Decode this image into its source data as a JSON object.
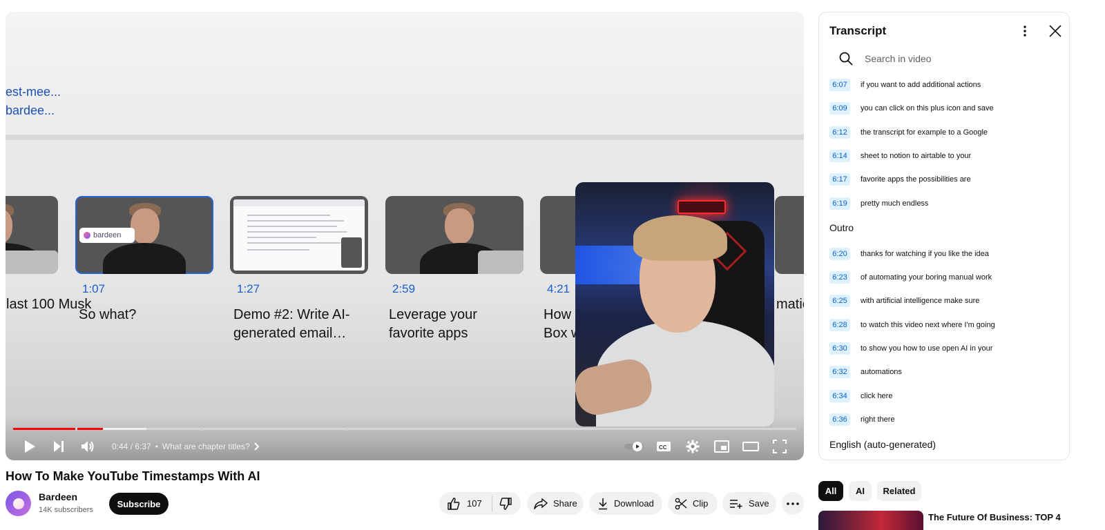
{
  "player": {
    "overlay_links": [
      "est-mee...",
      "bardee..."
    ],
    "chapters": [
      {
        "time": "",
        "title": "last 100 Musk",
        "style": "person",
        "active": false,
        "partial": "left"
      },
      {
        "time": "1:07",
        "title": "So what?",
        "style": "person-bardeen",
        "active": true
      },
      {
        "time": "1:27",
        "title": "Demo #2: Write AI-generated email…",
        "style": "doc",
        "active": false
      },
      {
        "time": "2:59",
        "title": "Leverage your favorite apps",
        "style": "person",
        "active": false
      },
      {
        "time": "4:21",
        "title": "How d Box w",
        "style": "doc2",
        "active": false
      },
      {
        "time": "",
        "title": "matic",
        "style": "grey",
        "active": false,
        "partial": "right"
      }
    ],
    "bardeen_tag": "bardeen",
    "progress": {
      "played_fraction": 0.115,
      "buffered_fraction": 0.17,
      "chapter_gaps": [
        0.079,
        0.24,
        0.424
      ]
    },
    "time_display": "0:44 / 6:37",
    "separator": "•",
    "current_chapter": "What are chapter titles?",
    "icons": {
      "left": [
        "play-icon",
        "next-icon",
        "volume-icon"
      ],
      "right": [
        "autoplay-toggle-icon",
        "captions-icon",
        "settings-icon",
        "miniplayer-icon",
        "theater-icon",
        "fullscreen-icon"
      ]
    }
  },
  "video": {
    "title": "How To Make YouTube Timestamps With AI",
    "channel_name": "Bardeen",
    "subscribers": "14K subscribers",
    "subscribe_label": "Subscribe",
    "like_count": "107",
    "share_label": "Share",
    "download_label": "Download",
    "clip_label": "Clip",
    "save_label": "Save"
  },
  "transcript": {
    "title": "Transcript",
    "search_placeholder": "Search in video",
    "entries": [
      {
        "time": "6:07",
        "text": "if you want to add additional actions"
      },
      {
        "time": "6:09",
        "text": "you can click on this plus icon and save"
      },
      {
        "time": "6:12",
        "text": "the transcript for example to a Google"
      },
      {
        "time": "6:14",
        "text": "sheet to notion to airtable to your"
      },
      {
        "time": "6:17",
        "text": "favorite apps the possibilities are"
      },
      {
        "time": "6:19",
        "text": "pretty much endless"
      }
    ],
    "section_label": "Outro",
    "entries2": [
      {
        "time": "6:20",
        "text": "thanks for watching if you like the idea"
      },
      {
        "time": "6:23",
        "text": "of automating your boring manual work"
      },
      {
        "time": "6:25",
        "text": "with artificial intelligence make sure"
      },
      {
        "time": "6:28",
        "text": "to watch this video next where I'm going"
      },
      {
        "time": "6:30",
        "text": "to show you how to use open AI in your"
      },
      {
        "time": "6:32",
        "text": "automations"
      },
      {
        "time": "6:34",
        "text": "click here"
      },
      {
        "time": "6:36",
        "text": "right there"
      }
    ],
    "language": "English (auto-generated)"
  },
  "chips": [
    "All",
    "AI",
    "Related"
  ],
  "recommendation": {
    "title": "The Future Of Business: TOP 4"
  }
}
